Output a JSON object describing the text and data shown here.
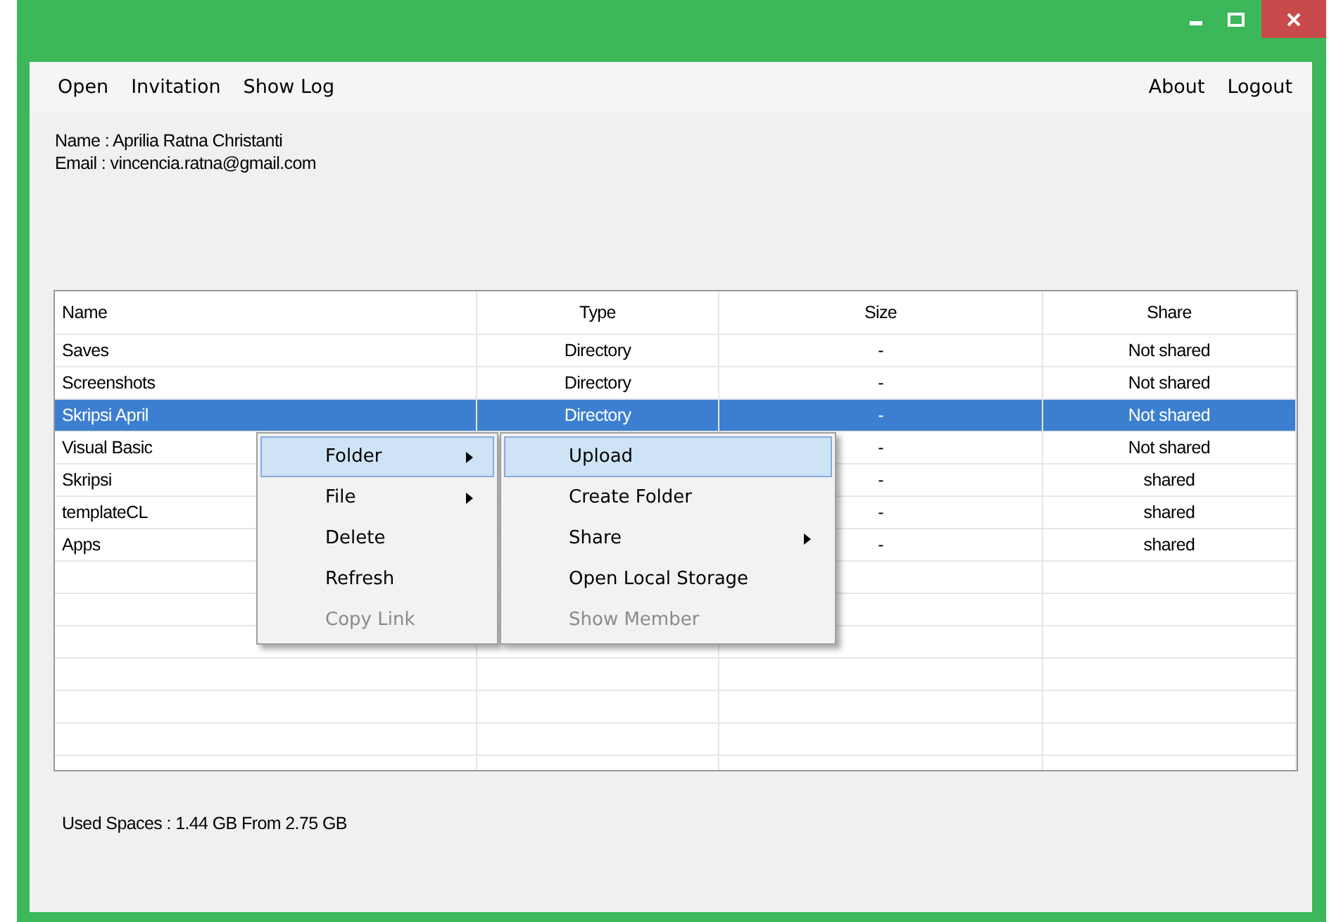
{
  "menu_bar": {
    "left": [
      "Open",
      "Invitation",
      "Show Log"
    ],
    "right": [
      "About",
      "Logout"
    ]
  },
  "user": {
    "name": "Name : Aprilia Ratna Christanti",
    "email": "Email : vincencia.ratna@gmail.com"
  },
  "table": {
    "columns": [
      "Name",
      "Type",
      "Size",
      "Share"
    ],
    "rows": [
      {
        "name": "Saves",
        "type": "Directory",
        "size": "-",
        "share": "Not shared",
        "selected": false
      },
      {
        "name": "Screenshots",
        "type": "Directory",
        "size": "-",
        "share": "Not shared",
        "selected": false
      },
      {
        "name": "Skripsi April",
        "type": "Directory",
        "size": "-",
        "share": "Not shared",
        "selected": true
      },
      {
        "name": "Visual Basic",
        "size": "-",
        "share": "Not shared",
        "selected": false
      },
      {
        "name": "Skripsi",
        "size": "-",
        "share": "shared",
        "selected": false
      },
      {
        "name": "templateCL",
        "size": "-",
        "share": "shared",
        "selected": false
      },
      {
        "name": "Apps",
        "size": "-",
        "share": "shared",
        "selected": false
      }
    ]
  },
  "context_menu": {
    "items": [
      {
        "label": "Folder",
        "submenu": true,
        "selected": true,
        "disabled": false
      },
      {
        "label": "File",
        "submenu": true,
        "selected": false,
        "disabled": false
      },
      {
        "label": "Delete",
        "submenu": false,
        "selected": false,
        "disabled": false
      },
      {
        "label": "Refresh",
        "submenu": false,
        "selected": false,
        "disabled": false
      },
      {
        "label": "Copy Link",
        "submenu": false,
        "selected": false,
        "disabled": true
      }
    ]
  },
  "submenu": {
    "items": [
      {
        "label": "Upload",
        "submenu": false,
        "selected": true,
        "disabled": false
      },
      {
        "label": "Create Folder",
        "submenu": false,
        "selected": false,
        "disabled": false
      },
      {
        "label": "Share",
        "submenu": true,
        "selected": false,
        "disabled": false
      },
      {
        "label": "Open Local Storage",
        "submenu": false,
        "selected": false,
        "disabled": false
      },
      {
        "label": "Show Member",
        "submenu": false,
        "selected": false,
        "disabled": true
      }
    ]
  },
  "status": "Used Spaces : 1.44 GB From 2.75 GB"
}
